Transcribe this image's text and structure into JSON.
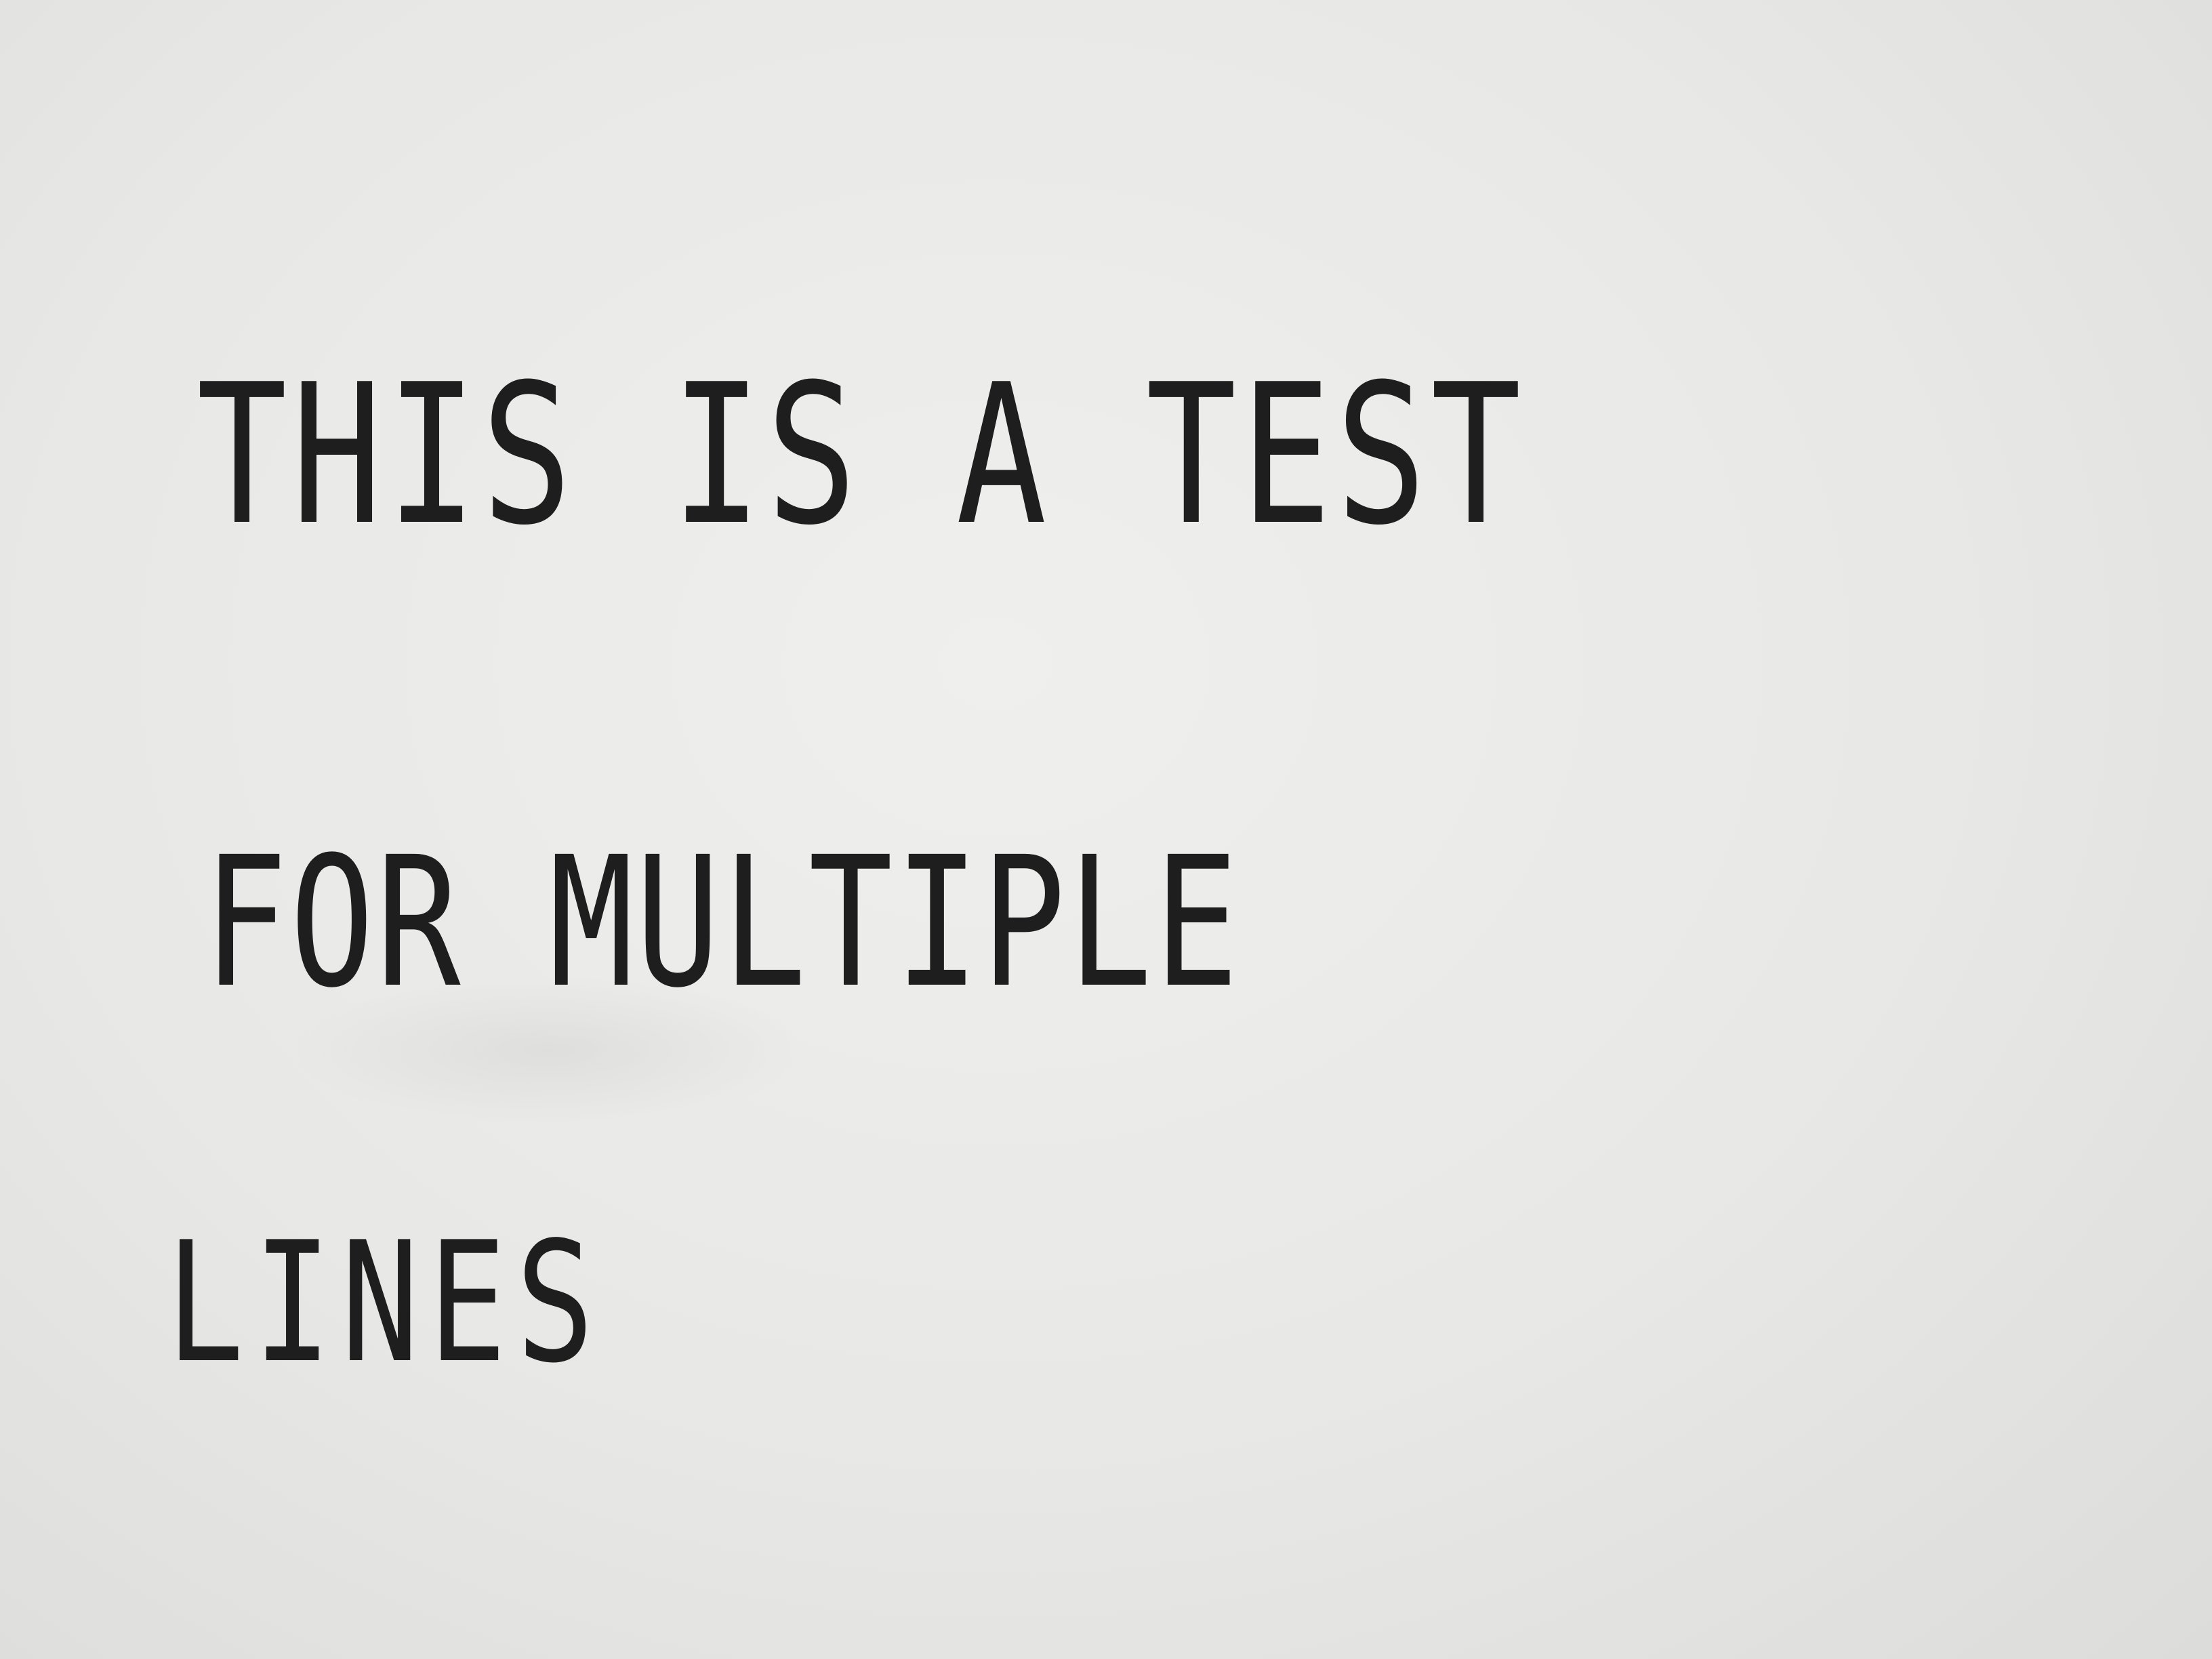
{
  "document": {
    "lines": [
      "THIS IS A TEST",
      "FOR MULTIPLE",
      "LINES"
    ]
  }
}
